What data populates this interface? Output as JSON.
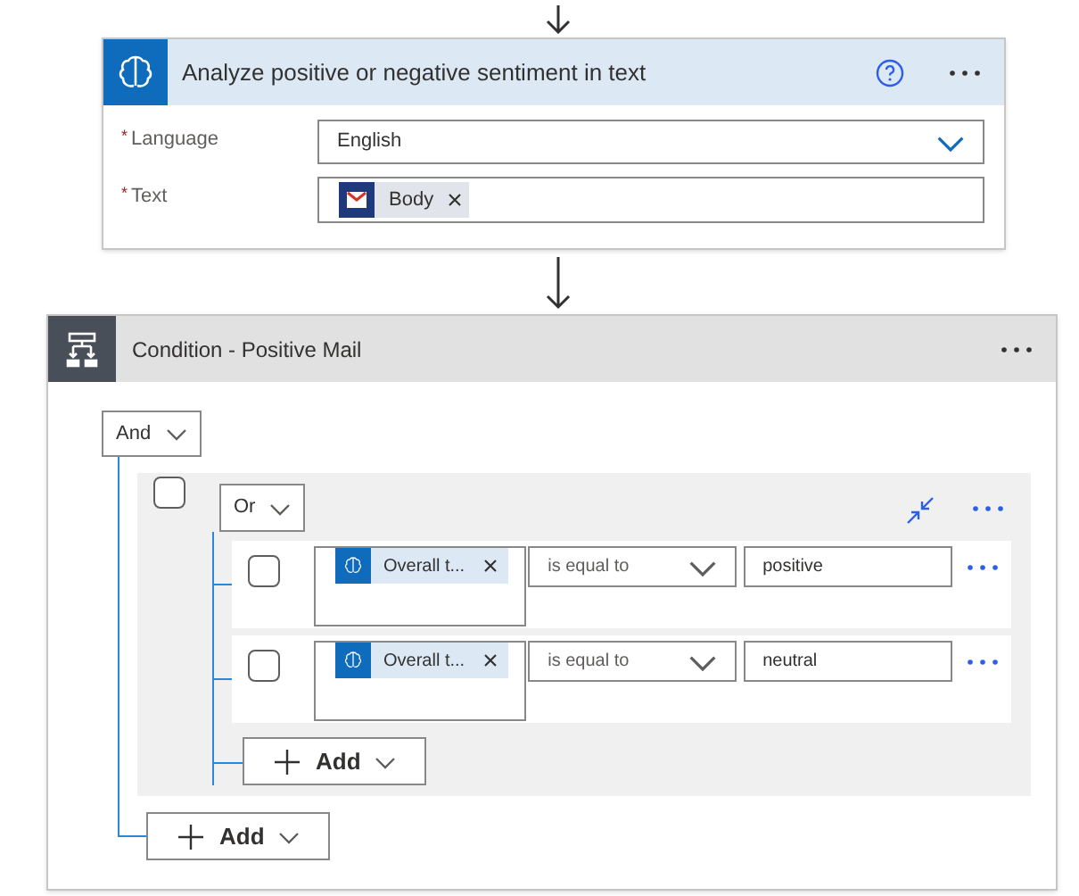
{
  "action": {
    "title": "Analyze positive or negative sentiment in text",
    "fields": [
      {
        "label": "Language",
        "required_mark": "*",
        "kind": "dropdown",
        "value": "English"
      },
      {
        "label": "Text",
        "required_mark": "*",
        "kind": "tokens",
        "tokens": [
          "Body"
        ]
      }
    ]
  },
  "condition": {
    "title": "Condition - Positive Mail",
    "operator": "And",
    "add_label": "Add",
    "group": {
      "checked": false,
      "operator": "Or",
      "add_label": "Add",
      "rows": [
        {
          "checked": false,
          "token": "Overall t...",
          "comparison": "is equal to",
          "value": "positive"
        },
        {
          "checked": false,
          "token": "Overall t...",
          "comparison": "is equal to",
          "value": "neutral"
        }
      ]
    }
  }
}
